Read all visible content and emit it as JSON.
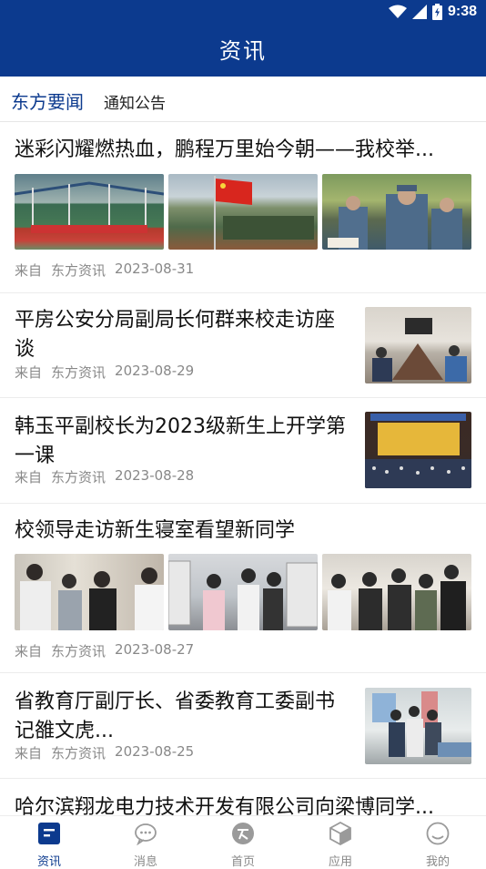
{
  "status_bar": {
    "time": "9:38"
  },
  "header": {
    "title": "资讯"
  },
  "tabs": [
    {
      "label": "东方要闻",
      "active": true
    },
    {
      "label": "通知公告",
      "active": false
    }
  ],
  "feed": [
    {
      "title": "迷彩闪耀燃热血，鹏程万里始今朝——我校举...",
      "source_prefix": "来自",
      "source": "东方资讯",
      "date": "2023-08-31"
    },
    {
      "title_line1": "平房公安分局副局长何群来校走访座",
      "title_line2": "谈",
      "source_prefix": "来自",
      "source": "东方资讯",
      "date": "2023-08-29"
    },
    {
      "title_line1": "韩玉平副校长为2023级新生上开学第",
      "title_line2": "一课",
      "source_prefix": "来自",
      "source": "东方资讯",
      "date": "2023-08-28"
    },
    {
      "title": "校领导走访新生寝室看望新同学",
      "source_prefix": "来自",
      "source": "东方资讯",
      "date": "2023-08-27"
    },
    {
      "title_line1": "省教育厅副厅长、省委教育工委副书",
      "title_line2": "记雒文虎...",
      "source_prefix": "来自",
      "source": "东方资讯",
      "date": "2023-08-25"
    },
    {
      "title": "哈尔滨翔龙电力技术开发有限公司向梁博同学..."
    }
  ],
  "bottom_nav": [
    {
      "label": "资讯",
      "icon": "news-icon",
      "active": true
    },
    {
      "label": "消息",
      "icon": "chat-bubble-icon",
      "active": false
    },
    {
      "label": "首页",
      "icon": "home-logo-icon",
      "active": false
    },
    {
      "label": "应用",
      "icon": "cube-icon",
      "active": false
    },
    {
      "label": "我的",
      "icon": "profile-icon",
      "active": false
    }
  ],
  "colors": {
    "brand": "#0c3a8e",
    "meta_text": "#888888"
  }
}
